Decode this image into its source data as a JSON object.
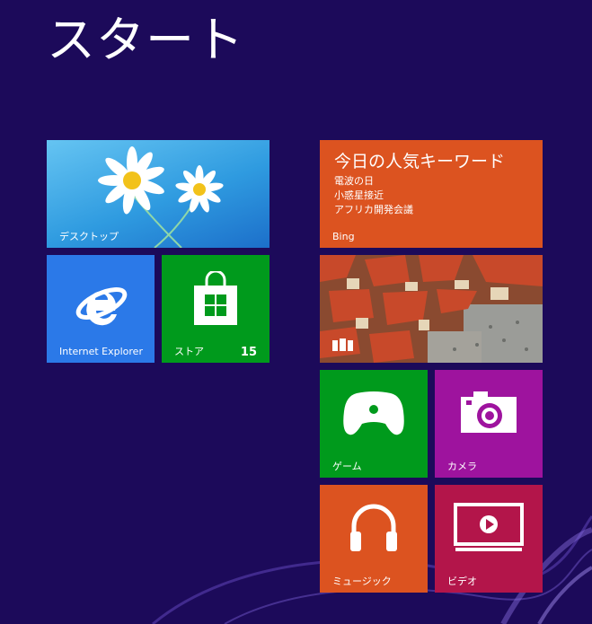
{
  "screen": {
    "title": "スタート"
  },
  "colors": {
    "background": "#1c0a5a",
    "blue_tile": "#2b79e8",
    "green_tile": "#009a1c",
    "orange_tile": "#dc5320",
    "purple_tile": "#9e139e",
    "crimson_tile": "#b3154a"
  },
  "tiles": {
    "desktop": {
      "label": "デスクトップ"
    },
    "ie": {
      "label": "Internet Explorer",
      "icon": "internet-explorer-icon"
    },
    "store": {
      "label": "ストア",
      "badge": "15",
      "icon": "store-bag-icon"
    },
    "bing": {
      "headline": "今日の人気キーワード",
      "lines": [
        "電波の日",
        "小惑星接近",
        "アフリカ開発会議"
      ],
      "label": "Bing"
    },
    "photos": {
      "icon": "photos-icon"
    },
    "games": {
      "label": "ゲーム",
      "icon": "game-controller-icon"
    },
    "camera": {
      "label": "カメラ",
      "icon": "camera-icon"
    },
    "music": {
      "label": "ミュージック",
      "icon": "headphones-icon"
    },
    "video": {
      "label": "ビデオ",
      "icon": "video-player-icon"
    }
  }
}
